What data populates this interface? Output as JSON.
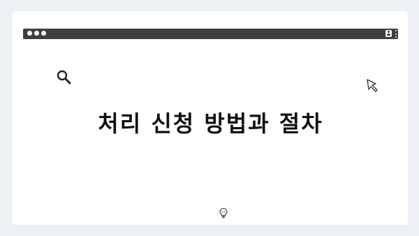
{
  "pager": {
    "dots": [
      "page-1",
      "page-2",
      "page-3",
      "page-4"
    ]
  },
  "window": {
    "titlebar_color": "#3e3f41",
    "traffic_lights": [
      "dot",
      "dot",
      "dot"
    ],
    "profile_icon": "user-icon",
    "menu_icon": "kebab-menu-icon"
  },
  "content": {
    "search_icon": "search-icon",
    "cursor_icon": "pointer-cursor-icon",
    "headline": "처리 신청 방법과 절차",
    "bulb_icon": "lightbulb-icon"
  },
  "colors": {
    "background": "#edf0f4",
    "window": "#ffffff",
    "text": "#111111"
  }
}
